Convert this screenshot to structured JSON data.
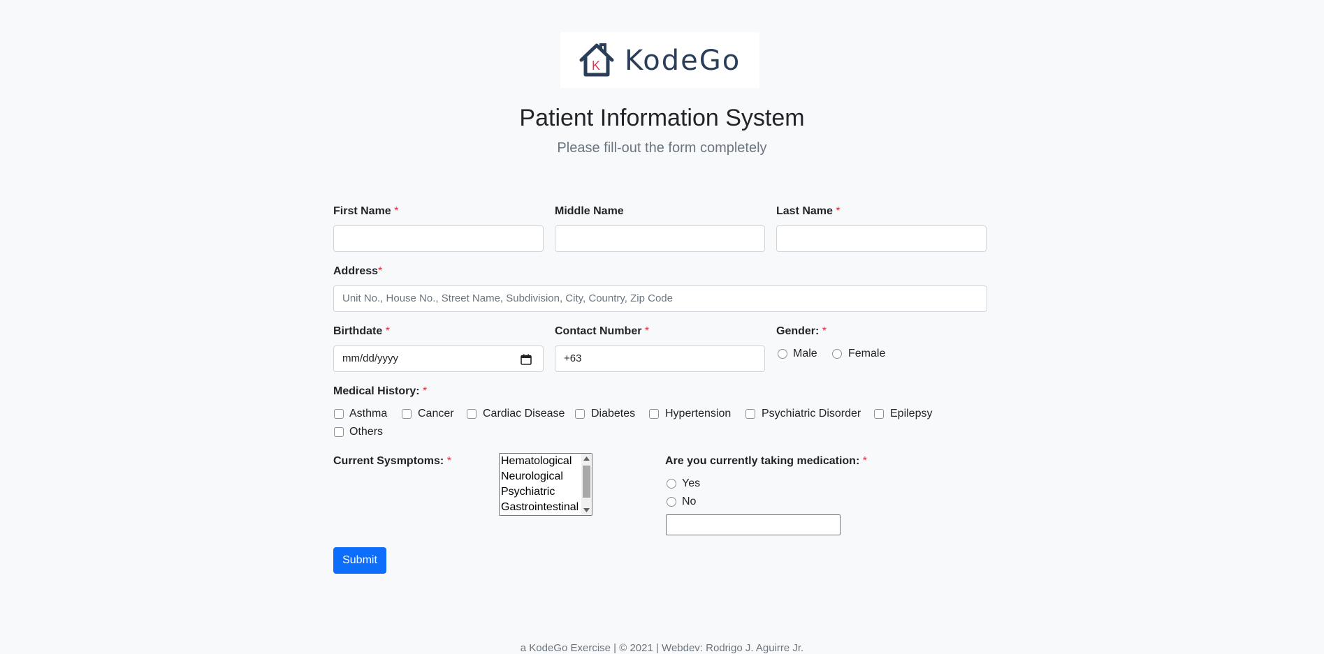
{
  "header": {
    "logo_text": "KodeGo",
    "logo_letter": "K",
    "title": "Patient Information System",
    "subtitle": "Please fill-out the form completely"
  },
  "form": {
    "required_mark": "*",
    "first_name": {
      "label": "First Name",
      "value": ""
    },
    "middle_name": {
      "label": "Middle Name",
      "value": ""
    },
    "last_name": {
      "label": "Last Name",
      "value": ""
    },
    "address": {
      "label": "Address",
      "placeholder": "Unit No., House No., Street Name, Subdivision, City, Country, Zip Code"
    },
    "birthdate": {
      "label": "Birthdate",
      "placeholder": "mm/dd/yyyy",
      "icon": "calendar-icon"
    },
    "contact": {
      "label": "Contact Number",
      "value": "+63"
    },
    "gender": {
      "label": "Gender:",
      "options": [
        "Male",
        "Female"
      ]
    },
    "medical_history": {
      "label": "Medical History:",
      "options": [
        "Asthma",
        "Cancer",
        "Cardiac Disease",
        "Diabetes",
        "Hypertension",
        "Psychiatric Disorder",
        "Epilepsy",
        "Others"
      ]
    },
    "symptoms": {
      "label": "Current Sysmptoms:",
      "options": [
        "Hematological",
        "Neurological",
        "Psychiatric",
        "Gastrointestinal"
      ]
    },
    "medication": {
      "label": "Are you currently taking medication:",
      "options": [
        "Yes",
        "No"
      ],
      "details_value": ""
    },
    "submit_label": "Submit"
  },
  "footer": {
    "text": "a KodeGo Exercise | © 2021 | Webdev: Rodrigo J. Aguirre Jr."
  },
  "colors": {
    "primary": "#0d6efd",
    "required": "#dc3545",
    "background": "#f8f9fa",
    "logo_dark": "#2a3d59",
    "logo_accent": "#e8335d"
  }
}
